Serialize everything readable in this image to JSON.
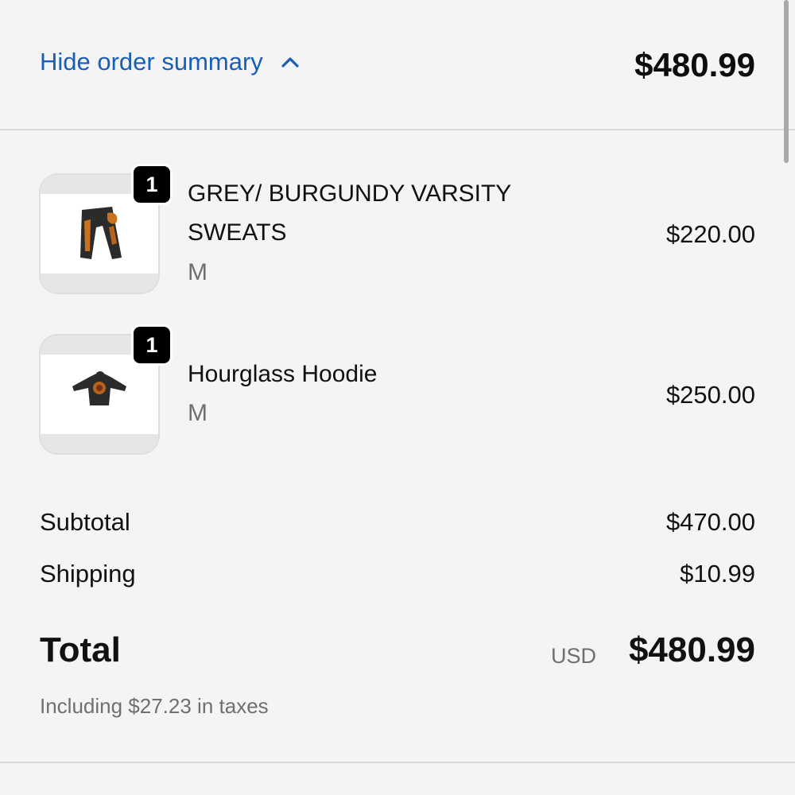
{
  "summary_toggle": {
    "label": "Hide order summary",
    "total": "$480.99"
  },
  "items": [
    {
      "name_line1": "GREY/ BURGUNDY VARSITY",
      "name_line2": "SWEATS",
      "variant": "M",
      "quantity": "1",
      "price": "$220.00",
      "image_icon": "sweatpants-icon"
    },
    {
      "name_line1": "Hourglass Hoodie",
      "name_line2": "",
      "variant": "M",
      "quantity": "1",
      "price": "$250.00",
      "image_icon": "hoodie-icon"
    }
  ],
  "costs": {
    "subtotal_label": "Subtotal",
    "subtotal_value": "$470.00",
    "shipping_label": "Shipping",
    "shipping_value": "$10.99"
  },
  "total": {
    "label": "Total",
    "currency": "USD",
    "value": "$480.99",
    "taxes_note": "Including $27.23 in taxes"
  },
  "colors": {
    "link": "#1a5fb4",
    "background": "#f4f4f4",
    "muted_text": "#6f6f6f",
    "badge": "#000000"
  }
}
